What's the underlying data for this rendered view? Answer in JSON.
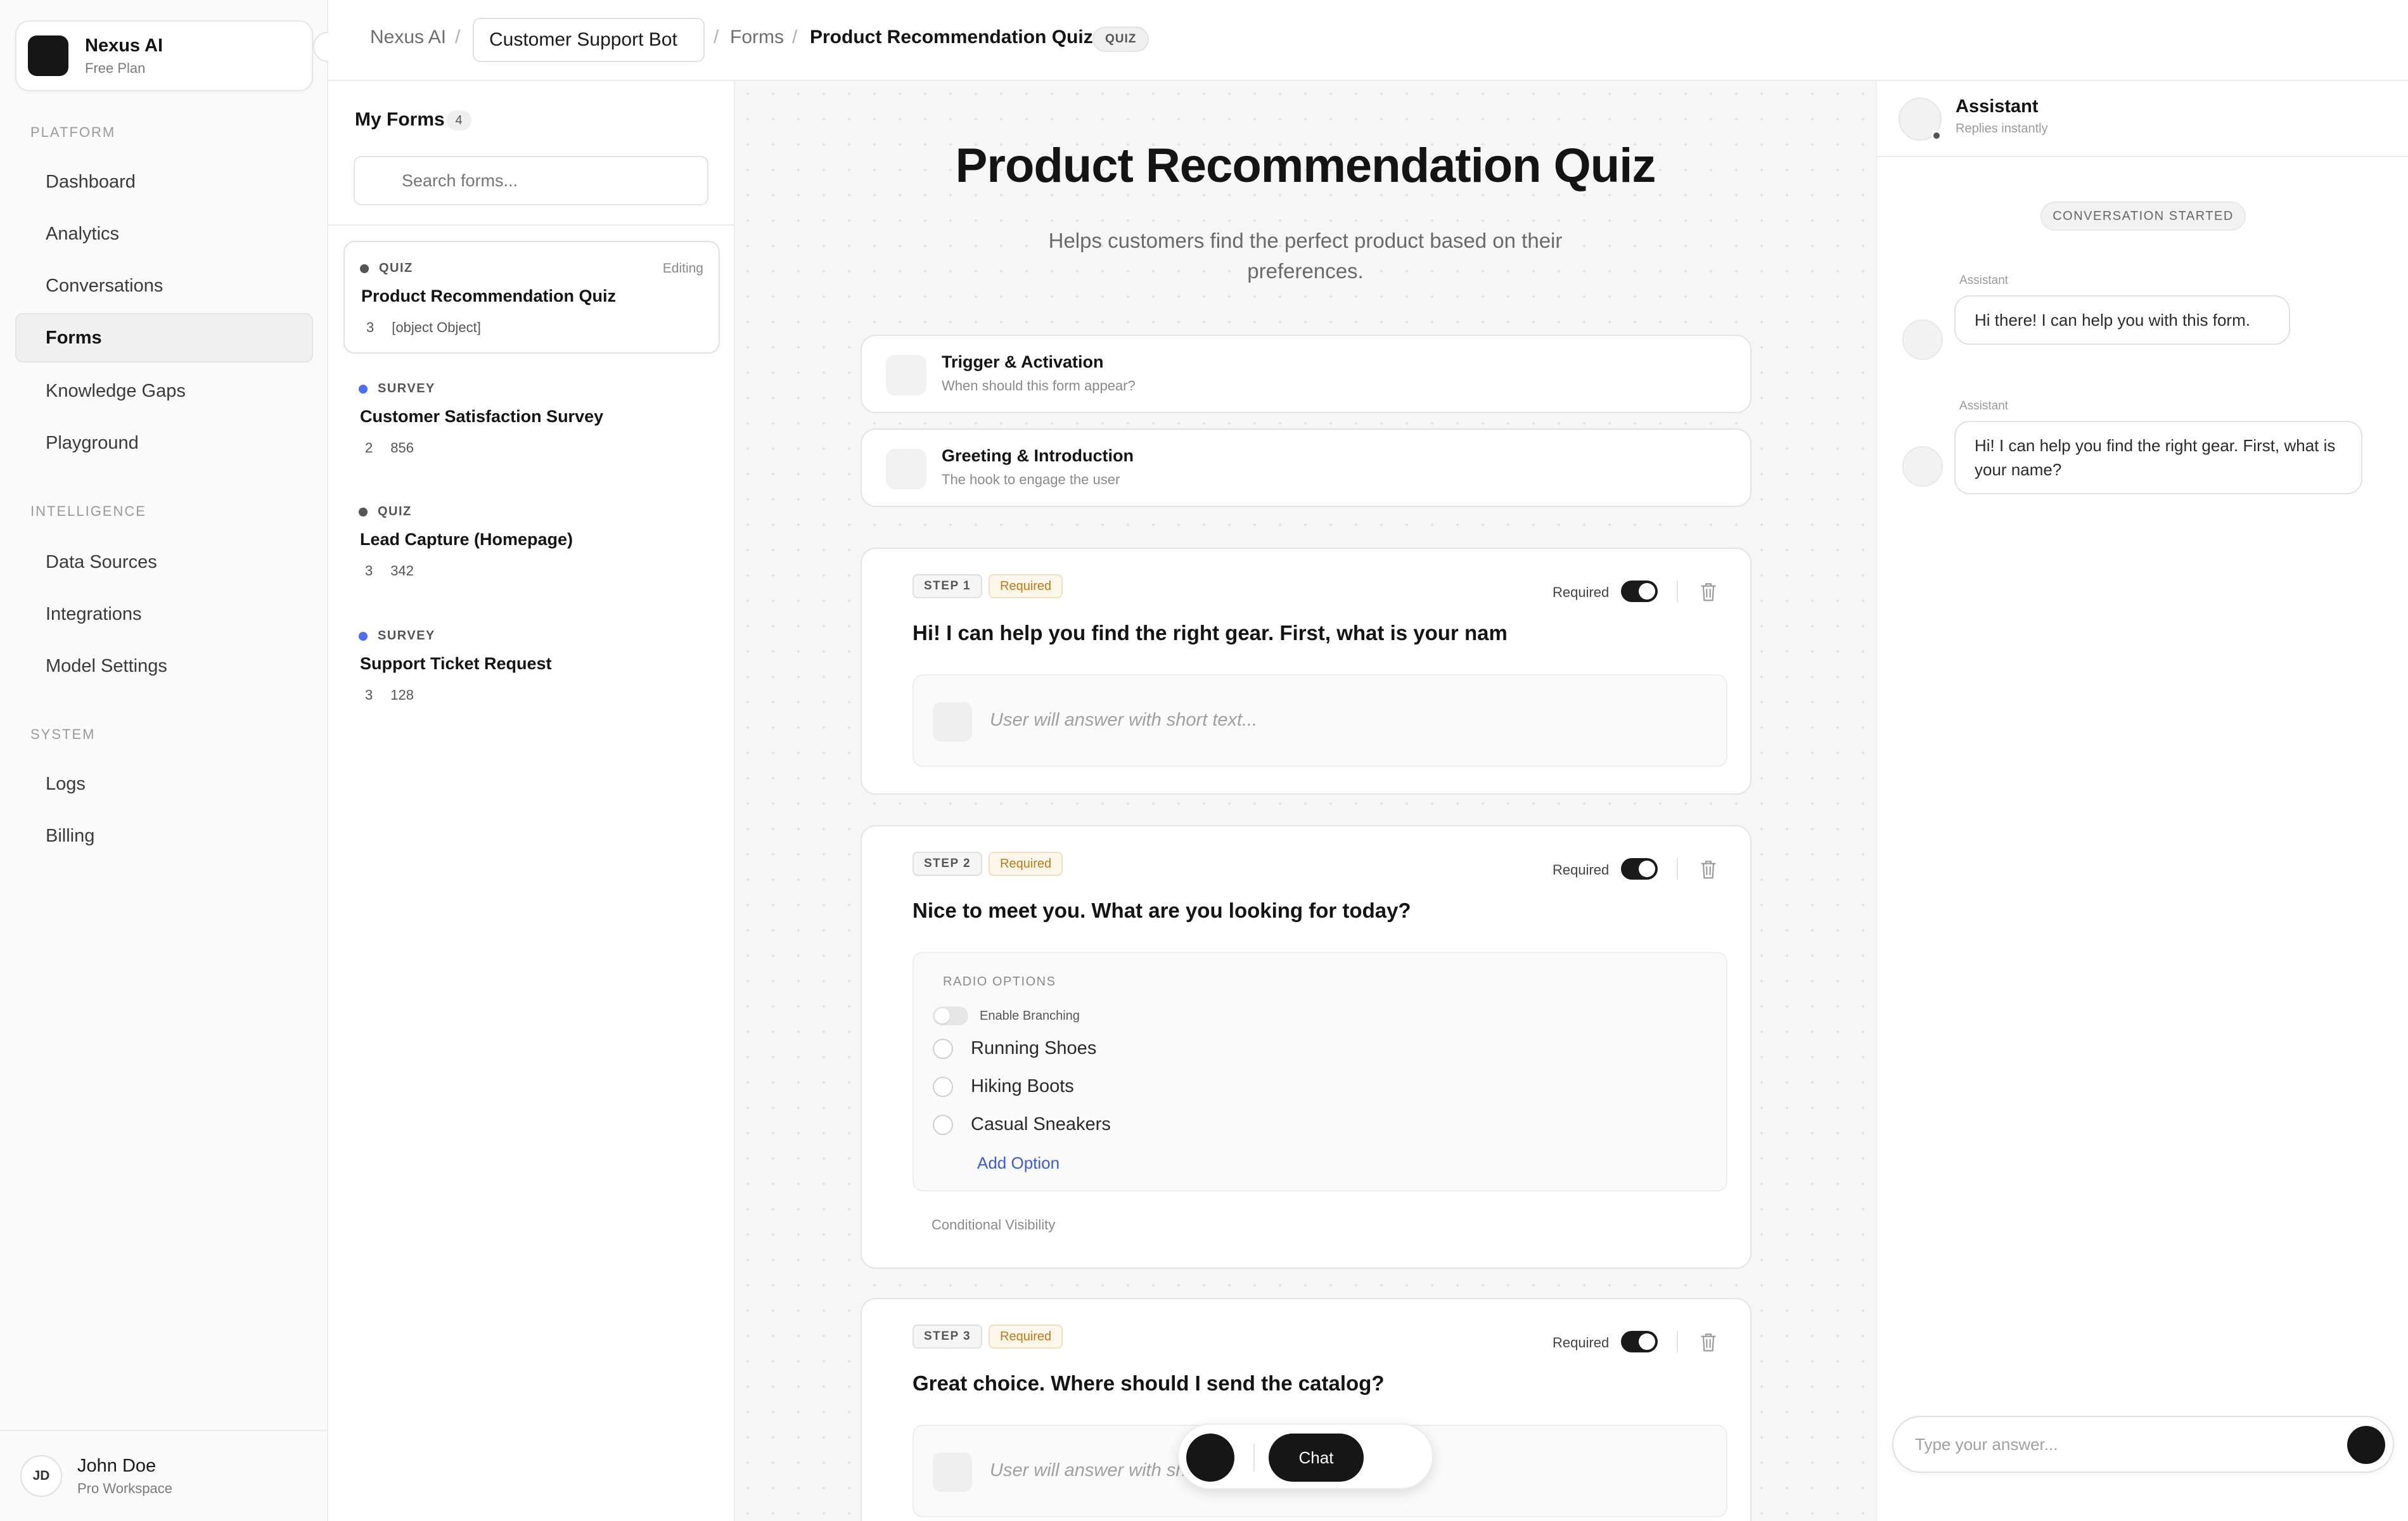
{
  "brand": {
    "name": "Nexus AI",
    "plan": "Free Plan"
  },
  "nav": {
    "sections": [
      {
        "title": "PLATFORM",
        "items": [
          "Dashboard",
          "Analytics",
          "Conversations",
          "Forms",
          "Knowledge Gaps",
          "Playground"
        ]
      },
      {
        "title": "INTELLIGENCE",
        "items": [
          "Data Sources",
          "Integrations",
          "Model Settings"
        ]
      },
      {
        "title": "SYSTEM",
        "items": [
          "Logs",
          "Billing"
        ]
      }
    ],
    "active": "Forms"
  },
  "user": {
    "initials": "JD",
    "name": "John Doe",
    "workspace": "Pro Workspace"
  },
  "breadcrumb": {
    "root": "Nexus AI",
    "bot": "Customer Support Bot",
    "section": "Forms",
    "current": "Product Recommendation Quiz",
    "tag": "QUIZ",
    "sep": "/"
  },
  "forms_panel": {
    "title": "My Forms",
    "count": "4",
    "search_placeholder": "Search forms...",
    "items": [
      {
        "type": "QUIZ",
        "status": "Editing",
        "name": "Product Recommendation Quiz",
        "steps": "3",
        "responses": "[object Object]",
        "dot_color": "#555555"
      },
      {
        "type": "SURVEY",
        "status": "",
        "name": "Customer Satisfaction Survey",
        "steps": "2",
        "responses": "856",
        "dot_color": "#4c6ef5"
      },
      {
        "type": "QUIZ",
        "status": "",
        "name": "Lead Capture (Homepage)",
        "steps": "3",
        "responses": "342",
        "dot_color": "#555555"
      },
      {
        "type": "SURVEY",
        "status": "",
        "name": "Support Ticket Request",
        "steps": "3",
        "responses": "128",
        "dot_color": "#4c6ef5"
      }
    ]
  },
  "editor": {
    "title": "Product Recommendation Quiz",
    "description": "Helps customers find the perfect product based on their preferences.",
    "sections": [
      {
        "title": "Trigger & Activation",
        "subtitle": "When should this form appear?"
      },
      {
        "title": "Greeting & Introduction",
        "subtitle": "The hook to engage the user"
      }
    ],
    "required_label": "Required",
    "steps": [
      {
        "badge": "STEP 1",
        "required": "Required",
        "question": "Hi! I can help you find the right gear. First, what is your nam",
        "answer_placeholder": "User will answer with short text..."
      },
      {
        "badge": "STEP 2",
        "required": "Required",
        "question": "Nice to meet you. What are you looking for today?",
        "options_heading": "RADIO OPTIONS",
        "branching_label": "Enable Branching",
        "options": [
          "Running Shoes",
          "Hiking Boots",
          "Casual Sneakers"
        ],
        "add_option": "Add Option",
        "conditional": "Conditional Visibility"
      },
      {
        "badge": "STEP 3",
        "required": "Required",
        "question": "Great choice. Where should I send the catalog?",
        "answer_placeholder": "User will answer with short text..."
      }
    ],
    "fab_label": "Chat"
  },
  "preview": {
    "name": "Assistant",
    "status": "Replies instantly",
    "conversation_started": "CONVERSATION STARTED",
    "messages": [
      {
        "author": "Assistant",
        "text": "Hi there! I can help you with this form."
      },
      {
        "author": "Assistant",
        "text": "Hi! I can help you find the right gear. First, what is your name?"
      }
    ],
    "input_placeholder": "Type your answer..."
  }
}
